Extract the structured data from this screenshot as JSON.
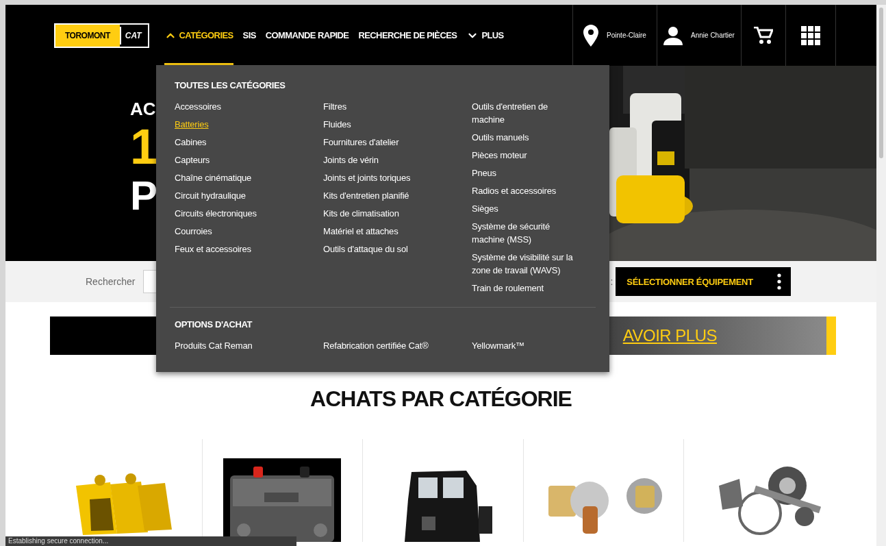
{
  "header": {
    "logo": {
      "brand": "TOROMONT",
      "mark": "CAT"
    },
    "nav": [
      {
        "label": "CATÉGORIES",
        "kind": "dropdown",
        "expanded": true
      },
      {
        "label": "SIS",
        "kind": "link"
      },
      {
        "label": "COMMANDE RAPIDE",
        "kind": "link"
      },
      {
        "label": "RECHERCHE DE PIÈCES",
        "kind": "link"
      },
      {
        "label": "PLUS",
        "kind": "dropdown",
        "expanded": false
      }
    ],
    "location": "Pointe-Claire",
    "user": "Annie Chartier"
  },
  "hero": {
    "line_1": "AC",
    "line_2": "1",
    "line_3": "P"
  },
  "search": {
    "label": "Rechercher",
    "equipment_label": ":",
    "equipment_button": "SÉLECTIONNER ÉQUIPEMENT"
  },
  "banner": {
    "link": "AVOIR PLUS"
  },
  "section_title": "ACHATS PAR CATÉGORIE",
  "category_cards": [
    {
      "kind": "bucket"
    },
    {
      "kind": "battery"
    },
    {
      "kind": "cab"
    },
    {
      "kind": "sensor"
    },
    {
      "kind": "gears"
    }
  ],
  "mega_menu": {
    "title": "TOUTES LES CATÉGORIES",
    "columns": [
      [
        {
          "label": "Accessoires",
          "hovered": false
        },
        {
          "label": "Batteries",
          "hovered": true
        },
        {
          "label": "Cabines",
          "hovered": false
        },
        {
          "label": "Capteurs",
          "hovered": false
        },
        {
          "label": "Chaîne cinématique",
          "hovered": false
        },
        {
          "label": "Circuit hydraulique",
          "hovered": false
        },
        {
          "label": "Circuits électroniques",
          "hovered": false
        },
        {
          "label": "Courroies",
          "hovered": false
        },
        {
          "label": "Feux et accessoires",
          "hovered": false
        }
      ],
      [
        {
          "label": "Filtres",
          "hovered": false
        },
        {
          "label": "Fluides",
          "hovered": false
        },
        {
          "label": "Fournitures d'atelier",
          "hovered": false
        },
        {
          "label": "Joints de vérin",
          "hovered": false
        },
        {
          "label": "Joints et joints toriques",
          "hovered": false
        },
        {
          "label": "Kits d'entretien planifié",
          "hovered": false
        },
        {
          "label": "Kits de climatisation",
          "hovered": false
        },
        {
          "label": "Matériel et attaches",
          "hovered": false
        },
        {
          "label": "Outils d'attaque du sol",
          "hovered": false
        }
      ],
      [
        {
          "label": "Outils d'entretien de machine",
          "hovered": false
        },
        {
          "label": "Outils manuels",
          "hovered": false
        },
        {
          "label": "Pièces moteur",
          "hovered": false
        },
        {
          "label": "Pneus",
          "hovered": false
        },
        {
          "label": "Radios et accessoires",
          "hovered": false
        },
        {
          "label": "Sièges",
          "hovered": false
        },
        {
          "label": "Système de sécurité machine (MSS)",
          "hovered": false
        },
        {
          "label": "Système de visibilité sur la zone de travail (WAVS)",
          "hovered": false
        },
        {
          "label": "Train de roulement",
          "hovered": false
        }
      ]
    ],
    "options_title": "OPTIONS D'ACHAT",
    "options": [
      {
        "label": "Produits Cat Reman",
        "hovered": false
      },
      {
        "label": "Refabrication certifiée Cat®",
        "hovered": false
      },
      {
        "label": "Yellowmark™",
        "hovered": false
      }
    ]
  },
  "status_bar": "Establishing secure connection..."
}
